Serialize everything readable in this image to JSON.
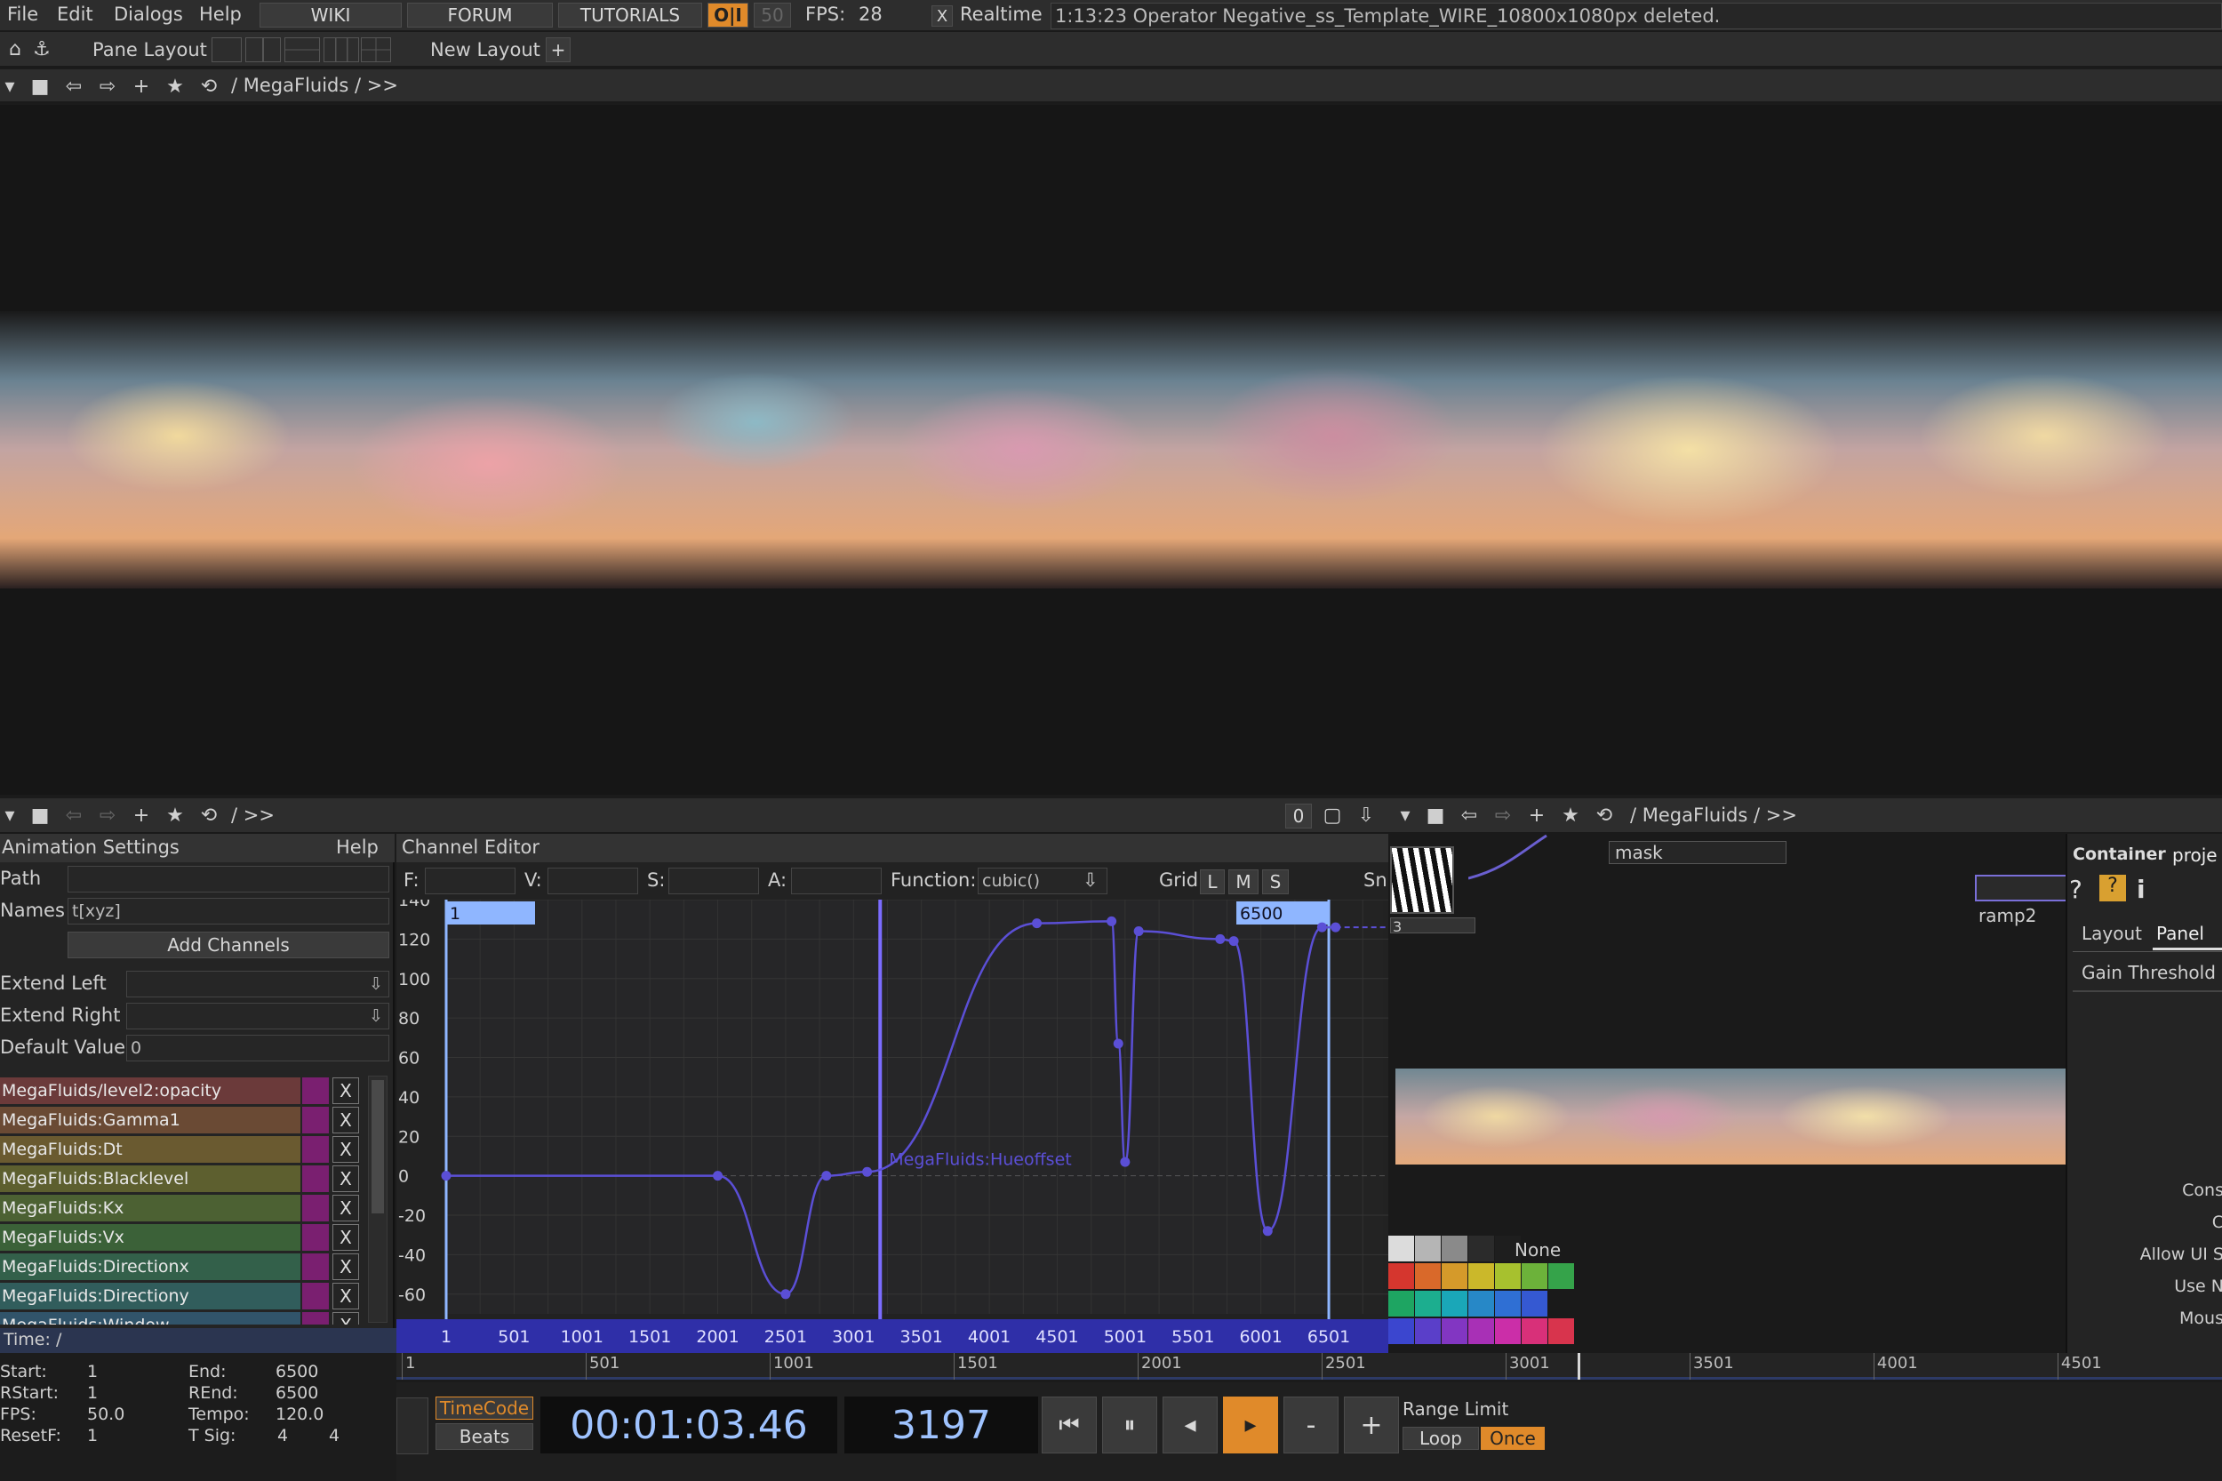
{
  "menu": {
    "file": "File",
    "edit": "Edit",
    "dialogs": "Dialogs",
    "help": "Help",
    "wiki": "WIKI",
    "forum": "FORUM",
    "tutorials": "TUTORIALS",
    "oi": "O|I",
    "fifty": "50",
    "fps_label": "FPS:",
    "fps_value": "28",
    "realtime_check": "X",
    "realtime": "Realtime",
    "message": "1:13:23 Operator Negative_ss_Template_WIRE_10800x1080px deleted."
  },
  "layout_bar": {
    "pane_layout": "Pane Layout",
    "new_layout": "New Layout",
    "plus": "+"
  },
  "top_pane": {
    "path": "/ MegaFluids / >>"
  },
  "bottom_left_bar": {
    "path": "/ >>",
    "zero": "0"
  },
  "network": {
    "path": "/ MegaFluids / >>",
    "mask": "mask",
    "ramp": "ramp2",
    "three": "3",
    "container": "Container",
    "proj": "proje",
    "tabs": {
      "layout": "Layout",
      "panel": "Panel"
    },
    "gain_threshold": "Gain Threshold",
    "side_labels": [
      "Cons",
      "C",
      "Allow UI S",
      "Use N",
      "Mous"
    ],
    "palette_none": "None",
    "palette": [
      [
        "#dcdcdc",
        "#b5b5b5",
        "#8a8a8a",
        "#2b2b2b",
        "#1e1e1e"
      ],
      [
        "#d5362e",
        "#d9692a",
        "#d59a2a",
        "#cbb82a",
        "#a7c12e",
        "#6cb23a",
        "#35a34a"
      ],
      [
        "#1ea562",
        "#1cae8f",
        "#1aa7b8",
        "#2788c7",
        "#2f6fd4",
        "#3559d2"
      ],
      [
        "#3b46cf",
        "#5a3fc9",
        "#8236c2",
        "#a830b6",
        "#cb2ea8",
        "#d83079",
        "#d8344d"
      ]
    ]
  },
  "anim_settings": {
    "title": "Animation Settings",
    "help": "Help",
    "path_label": "Path",
    "path_value": "",
    "names_label": "Names",
    "names_value": "t[xyz]",
    "add_channels": "Add Channels",
    "extend_left": "Extend Left",
    "extend_right": "Extend Right",
    "default_value_label": "Default Value",
    "default_value": "0",
    "channels": [
      {
        "name": "MegaFluids/level2:opacity",
        "color": "#6b3a3a"
      },
      {
        "name": "MegaFluids:Gamma1",
        "color": "#6a4a34"
      },
      {
        "name": "MegaFluids:Dt",
        "color": "#6a5a30"
      },
      {
        "name": "MegaFluids:Blacklevel",
        "color": "#5d5f2f"
      },
      {
        "name": "MegaFluids:Kx",
        "color": "#4c6133"
      },
      {
        "name": "MegaFluids:Vx",
        "color": "#3b6138"
      },
      {
        "name": "MegaFluids:Directionx",
        "color": "#33604a"
      },
      {
        "name": "MegaFluids:Directiony",
        "color": "#315d5c"
      },
      {
        "name": "MegaFluids:Window",
        "color": "#31546a"
      }
    ],
    "remove": "X"
  },
  "channel_editor": {
    "title": "Channel Editor",
    "f_label": "F:",
    "v_label": "V:",
    "s_label": "S:",
    "a_label": "A:",
    "function_label": "Function:",
    "function_value": "cubic()",
    "grid_label": "Grid",
    "grid_l": "L",
    "grid_m": "M",
    "grid_s": "S",
    "snap": "Sn",
    "start_marker": "1",
    "end_marker": "6500",
    "curve_label": "MegaFluids:Hueoffset",
    "y_ticks": [
      "140",
      "120",
      "100",
      "80",
      "60",
      "40",
      "20",
      "0",
      "-20",
      "-40",
      "-60"
    ],
    "x_ticks": [
      "1",
      "501",
      "1001",
      "1501",
      "2001",
      "2501",
      "3001",
      "3501",
      "4001",
      "4501",
      "5001",
      "5501",
      "6001",
      "6501"
    ]
  },
  "chart_data": {
    "type": "line",
    "title": "",
    "xlabel": "",
    "ylabel": "",
    "xlim": [
      1,
      6900
    ],
    "ylim": [
      -70,
      140
    ],
    "grid": true,
    "series": [
      {
        "name": "MegaFluids:Hueoffset",
        "x": [
          1,
          2001,
          2501,
          2801,
          3101,
          4351,
          4901,
          4951,
          5001,
          5101,
          5701,
          5801,
          6051,
          6451,
          6551
        ],
        "y": [
          0,
          0,
          -60,
          0,
          2,
          128,
          129,
          67,
          7,
          124,
          120,
          119,
          -28,
          126,
          126
        ]
      }
    ],
    "current_frame": 3197
  },
  "time": {
    "title": "Time: /",
    "start_label": "Start:",
    "start": "1",
    "end_label": "End:",
    "end": "6500",
    "rstart_label": "RStart:",
    "rstart": "1",
    "rend_label": "REnd:",
    "rend": "6500",
    "fps_label": "FPS:",
    "fps": "50.0",
    "tempo_label": "Tempo:",
    "tempo": "120.0",
    "resetf_label": "ResetF:",
    "resetf": "1",
    "tsig_label": "T Sig:",
    "tsig_a": "4",
    "tsig_b": "4",
    "timecode": "TimeCode",
    "beats": "Beats",
    "timecode_display": "00:01:03.46",
    "frame_display": "3197",
    "minus": "-",
    "plus": "+",
    "range_limit": "Range Limit",
    "loop": "Loop",
    "once": "Once",
    "ruler": [
      "1",
      "501",
      "1001",
      "1501",
      "2001",
      "2501",
      "3001",
      "3501",
      "4001",
      "4501"
    ]
  },
  "colors": {
    "accent": "#e08a2a",
    "curve": "#5b4fd6",
    "marker": "#8fb6ff"
  }
}
